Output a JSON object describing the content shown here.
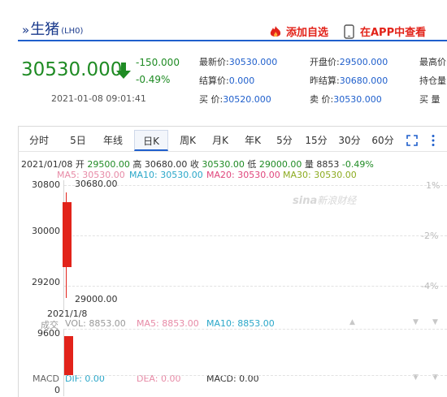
{
  "header": {
    "chevron": "»",
    "name": "生猪",
    "code": "(LH0)",
    "add_watchlist": "添加自选",
    "app_view": "在APP中查看"
  },
  "quote": {
    "price": "30530.000",
    "change": "-150.000",
    "change_pct": "-0.49%",
    "timestamp": "2021-01-08 09:01:41",
    "fields": [
      {
        "label": "最新价:",
        "value": "30530.000"
      },
      {
        "label": "结算价:",
        "value": "0.000"
      },
      {
        "label": "买  价:",
        "value": "30520.000"
      },
      {
        "label": "开盘价:",
        "value": "29500.000"
      },
      {
        "label": "昨结算:",
        "value": "30680.000"
      },
      {
        "label": "卖  价:",
        "value": "30530.000"
      },
      {
        "label": "最高价",
        "value": ""
      },
      {
        "label": "持仓量",
        "value": ""
      },
      {
        "label": "买  量",
        "value": ""
      }
    ]
  },
  "tabs": [
    "分时",
    "5日",
    "年线",
    "日K",
    "周K",
    "月K",
    "年K",
    "5分",
    "15分",
    "30分",
    "60分"
  ],
  "active_tab": "日K",
  "ohlc": {
    "date": "2021/01/08",
    "open_label": "开",
    "open": "29500.00",
    "high_label": "高",
    "high": "30680.00",
    "close_label": "收",
    "close": "30530.00",
    "low_label": "低",
    "low": "29000.00",
    "vol_label": "量",
    "vol": "8853",
    "chg": "-0.49%"
  },
  "ma": [
    {
      "text": "MA5: 30530.00",
      "color": "#e78aa6"
    },
    {
      "text": "MA10: 30530.00",
      "color": "#2aa7c9"
    },
    {
      "text": "MA20: 30530.00",
      "color": "#e0467c"
    },
    {
      "text": "MA30: 30530.00",
      "color": "#8cab1f"
    }
  ],
  "price_axis": [
    "30800",
    "30000",
    "29200"
  ],
  "pct_axis": [
    "1%",
    "-2%",
    "-4%"
  ],
  "high_label": "30680.00",
  "low_label": "29000.00",
  "date_label": "2021/1/8",
  "volume": {
    "label": "成交",
    "vol": "VOL: 8853.00",
    "ma5": "MA5: 8853.00",
    "ma10": "MA10: 8853.00",
    "axis_top": "9600",
    "colors": {
      "vol": "#2aa7c9",
      "ma5": "#e78aa6",
      "ma10": "#2aa7c9"
    }
  },
  "macd": {
    "label": "MACD",
    "dif": "DIF: 0.00",
    "dea": "DEA: 0.00",
    "macd": "MACD: 0.00",
    "axis_bottom": "0"
  },
  "watermark": {
    "brand": "sina",
    "text": "新浪财经"
  },
  "candle": {
    "open": 29500,
    "high": 30680,
    "low": 29000,
    "close": 30530
  },
  "volume_value": 8853,
  "colors": {
    "up": "#e2231a",
    "down_text": "#1f8b24",
    "accent": "#1f5fcc"
  }
}
